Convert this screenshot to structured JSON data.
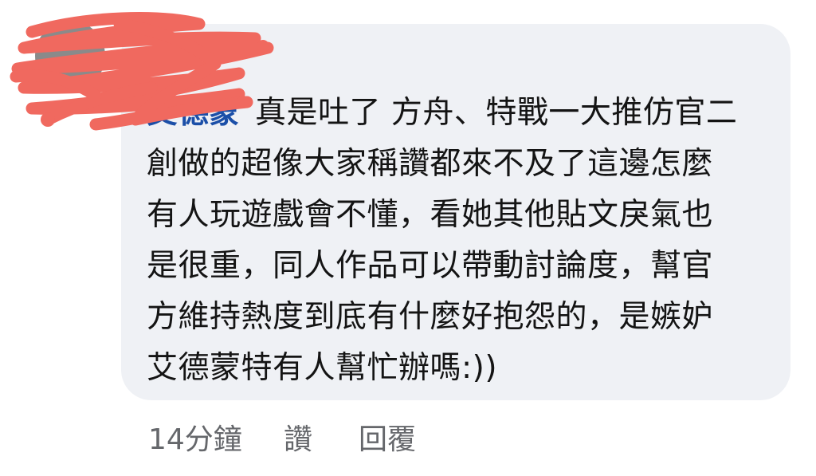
{
  "comment": {
    "author_name": "艾德蒙",
    "author_redacted": true,
    "lines": [
      "真是吐了 方舟、特戰一大推仿官二",
      "創做的超像大家稱讚都來不及了這邊怎麼",
      "有人玩遊戲會不懂，看她其他貼文戾氣也",
      "是很重，同人作品可以帶動討論度，幫官",
      "方維持熱度到底有什麼好抱怨的，是嫉妒",
      "艾德蒙特有人幫忙辦嗎:))"
    ]
  },
  "actions": {
    "timestamp": "14分鐘",
    "like_label": "讚",
    "reply_label": "回覆"
  },
  "colors": {
    "bubble_background": "#eff1f5",
    "text": "#141414",
    "meta_text": "#65676b",
    "redaction_scribble": "#f0695f",
    "author_link": "#1b4fa8"
  }
}
